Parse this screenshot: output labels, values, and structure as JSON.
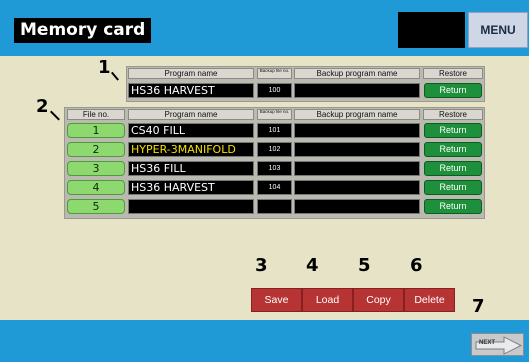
{
  "header": {
    "title": "Memory card",
    "menu_label": "MENU"
  },
  "table1": {
    "headers": {
      "program_name": "Program name",
      "backup_file_no": "Backup file no.",
      "backup_program_name": "Backup program name",
      "restore": "Restore"
    },
    "row": {
      "program_name": "HS36 HARVEST",
      "backup_no": "100",
      "backup_program_name": "",
      "restore_label": "Return"
    }
  },
  "table2": {
    "headers": {
      "file_no": "File no.",
      "program_name": "Program name",
      "backup_file_no": "Backup file no.",
      "backup_program_name": "Backup program name",
      "restore": "Restore"
    },
    "rows": [
      {
        "file_no": "1",
        "program_name": "CS40 FILL",
        "backup_no": "101",
        "backup_program_name": "",
        "restore_label": "Return"
      },
      {
        "file_no": "2",
        "program_name": "HYPER-3MANIFOLD",
        "backup_no": "102",
        "backup_program_name": "",
        "restore_label": "Return"
      },
      {
        "file_no": "3",
        "program_name": "HS36 FILL",
        "backup_no": "103",
        "backup_program_name": "",
        "restore_label": "Return"
      },
      {
        "file_no": "4",
        "program_name": "HS36 HARVEST",
        "backup_no": "104",
        "backup_program_name": "",
        "restore_label": "Return"
      },
      {
        "file_no": "5",
        "program_name": "",
        "backup_no": "",
        "backup_program_name": "",
        "restore_label": "Return"
      }
    ]
  },
  "actions": {
    "save": "Save",
    "load": "Load",
    "copy": "Copy",
    "delete": "Delete"
  },
  "footer": {
    "next_label": "NEXT"
  },
  "callouts": [
    "1",
    "2",
    "3",
    "4",
    "5",
    "6",
    "7"
  ],
  "colors": {
    "header_bg": "#1f9ad6",
    "panel_bg": "#e7e3c7",
    "return_green": "#1e8f3a",
    "file_green": "#8dd86f",
    "action_red": "#b73434",
    "highlight_yellow": "#f3e100"
  }
}
